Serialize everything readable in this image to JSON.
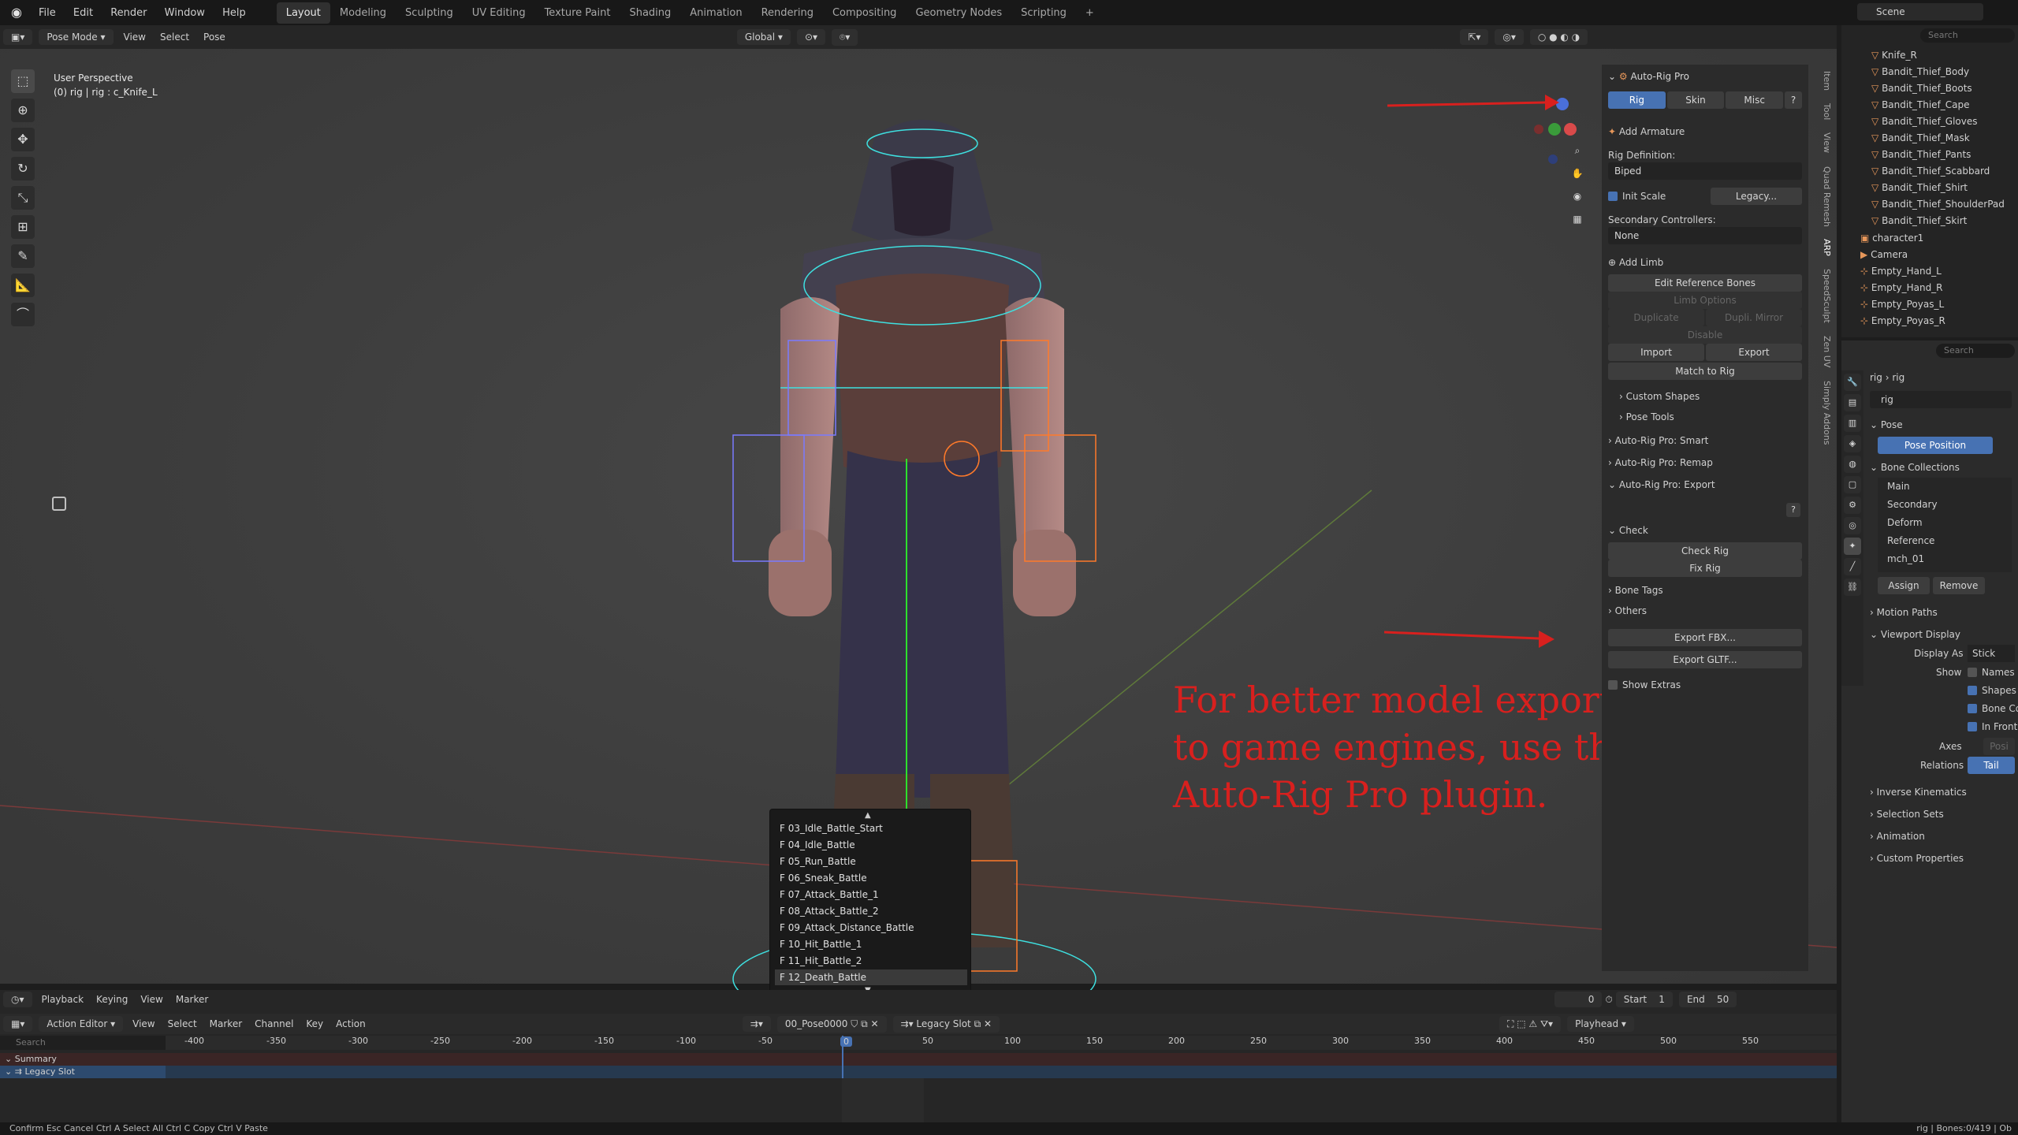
{
  "topbar": {
    "menus": [
      "File",
      "Edit",
      "Render",
      "Window",
      "Help"
    ],
    "workspaces": [
      "Layout",
      "Modeling",
      "Sculpting",
      "UV Editing",
      "Texture Paint",
      "Shading",
      "Animation",
      "Rendering",
      "Compositing",
      "Geometry Nodes",
      "Scripting"
    ],
    "active_workspace": "Layout",
    "add_tab": "+",
    "scene": "Scene"
  },
  "viewport_header": {
    "mode": "Pose Mode",
    "menus": [
      "View",
      "Select",
      "Pose"
    ],
    "orientation": "Global",
    "pose_options": "Pose Options"
  },
  "viewport": {
    "perspective": "User Perspective",
    "context": "(0) rig | rig : c_Knife_L",
    "annotation": "For better model export to game engines, use the Auto-Rig Pro plugin.",
    "annotation_lines": [
      "For better model export",
      "to game engines, use the",
      "Auto-Rig Pro plugin."
    ],
    "annotation_color": "#d8201e"
  },
  "npanel": {
    "title": "Auto-Rig Pro",
    "tabs": [
      "Rig",
      "Skin",
      "Misc"
    ],
    "active_tab": "Rig",
    "add_armature": "Add Armature",
    "rig_definition_label": "Rig Definition:",
    "rig_definition": "Biped",
    "init_scale": "Init Scale",
    "legacy": "Legacy...",
    "secondary_label": "Secondary Controllers:",
    "secondary_value": "None",
    "add_limb": "Add Limb",
    "edit_ref": "Edit Reference Bones",
    "limb_options": "Limb Options",
    "duplicate": "Duplicate",
    "dupli_mirror": "Dupli. Mirror",
    "disable": "Disable",
    "import": "Import",
    "export": "Export",
    "match_to_rig": "Match to Rig",
    "custom_shapes": "Custom Shapes",
    "pose_tools": "Pose Tools",
    "smart": "Auto-Rig Pro: Smart",
    "remap": "Auto-Rig Pro: Remap",
    "export_section": "Auto-Rig Pro: Export",
    "check": "Check",
    "check_rig": "Check Rig",
    "fix_rig": "Fix Rig",
    "bone_tags": "Bone Tags",
    "others": "Others",
    "export_fbx": "Export FBX...",
    "export_gltf": "Export GLTF...",
    "show_extras": "Show Extras"
  },
  "side_tabs": [
    "Item",
    "Tool",
    "View",
    "Quad Remesh",
    "ARP",
    "SpeedSculpt",
    "Zen UV",
    "Simply Addons"
  ],
  "outliner": {
    "search_placeholder": "Search",
    "items": [
      "Knife_R",
      "Bandit_Thief_Body",
      "Bandit_Thief_Boots",
      "Bandit_Thief_Cape",
      "Bandit_Thief_Gloves",
      "Bandit_Thief_Mask",
      "Bandit_Thief_Pants",
      "Bandit_Thief_Scabbard",
      "Bandit_Thief_Shirt",
      "Bandit_Thief_ShoulderPad",
      "Bandit_Thief_Skirt"
    ],
    "top_items": [
      "character1",
      "Camera",
      "Empty_Hand_L",
      "Empty_Hand_R",
      "Empty_Poyas_L",
      "Empty_Poyas_R"
    ]
  },
  "properties": {
    "search_placeholder": "Search",
    "breadcrumb": [
      "rig",
      "rig"
    ],
    "datablock": "rig",
    "pose": "Pose",
    "pose_position": "Pose Position",
    "bone_collections": "Bone Collections",
    "collections": [
      "Main",
      "Secondary",
      "Deform",
      "Reference",
      "mch_01"
    ],
    "assign": "Assign",
    "remove": "Remove",
    "motion_paths": "Motion Paths",
    "viewport_display": "Viewport Display",
    "display_as_label": "Display As",
    "display_as": "Stick",
    "show_label": "Show",
    "show_items": [
      "Names",
      "Shapes",
      "Bone Co",
      "In Front"
    ],
    "axes": "Axes",
    "axes_value": "Posi",
    "relations": "Relations",
    "relations_value": "Tail",
    "sections": [
      "Inverse Kinematics",
      "Selection Sets",
      "Animation",
      "Custom Properties"
    ]
  },
  "timeline": {
    "menus": [
      "Playback",
      "Keying",
      "View",
      "Marker"
    ],
    "current_frame": "0",
    "start_label": "Start",
    "start": "1",
    "end_label": "End",
    "end": "50"
  },
  "action_editor": {
    "mode": "Action Editor",
    "menus": [
      "View",
      "Select",
      "Marker",
      "Channel",
      "Key",
      "Action"
    ],
    "action": "00_Pose0000",
    "slot": "Legacy Slot",
    "playhead": "Playhead",
    "search_placeholder": "Search",
    "summary": "Summary",
    "channel": "Legacy Slot",
    "ruler": [
      "-400",
      "-350",
      "-300",
      "-250",
      "-200",
      "-150",
      "-100",
      "-50",
      "0",
      "50",
      "100",
      "150",
      "200",
      "250",
      "300",
      "350",
      "400",
      "450",
      "500",
      "550"
    ]
  },
  "dropdown": {
    "items": [
      "F 03_Idle_Battle_Start",
      "F 04_Idle_Battle",
      "F 05_Run_Battle",
      "F 06_Sneak_Battle",
      "F 07_Attack_Battle_1",
      "F 08_Attack_Battle_2",
      "F 09_Attack_Distance_Battle",
      "F 10_Hit_Battle_1",
      "F 11_Hit_Battle_2",
      "F 12_Death_Battle"
    ],
    "selected": "F 12_Death_Battle"
  },
  "statusbar": {
    "left": [
      [
        "Confirm",
        "Esc",
        "Cancel",
        "Ctrl A",
        "Select All",
        "Ctrl C",
        "Copy",
        "Ctrl V",
        "Paste"
      ]
    ],
    "hints": "Confirm   Esc Cancel   Ctrl A Select All   Ctrl C Copy   Ctrl V Paste",
    "right": "rig | Bones:0/419 | Ob"
  }
}
